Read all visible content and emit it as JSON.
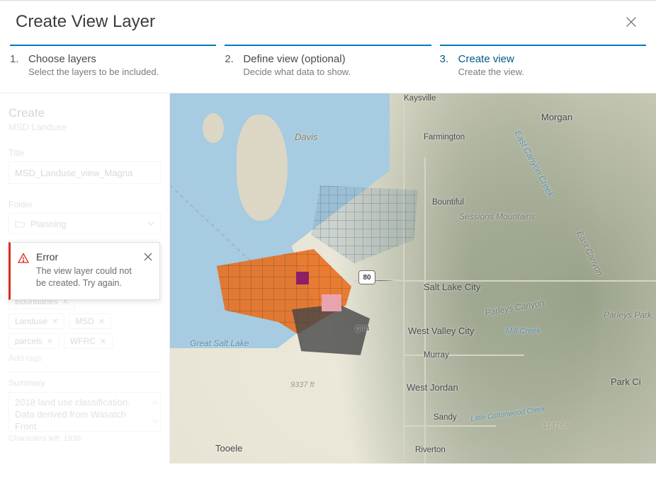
{
  "dialog": {
    "title": "Create View Layer"
  },
  "steps": [
    {
      "num": "1.",
      "title": "Choose layers",
      "sub": "Select the layers to be included."
    },
    {
      "num": "2.",
      "title": "Define view (optional)",
      "sub": "Decide what data to show."
    },
    {
      "num": "3.",
      "title": "Create view",
      "sub": "Create the view."
    }
  ],
  "side": {
    "create_heading": "Create",
    "source_name": "MSD Landuse",
    "title_label": "Title",
    "title_value": "MSD_Landuse_view_Magna",
    "folder_label": "Folder",
    "folder_value": "Planning",
    "tags_hidden_first": "Boundaries",
    "tags": [
      "Landuse",
      "MSD",
      "parcels",
      "WFRC"
    ],
    "add_tags": "Add tags",
    "summary_label": "Summary",
    "summary_value": "2018 land use classification. Data derived from Wasatch Front",
    "chars_left": "Characters left: 1938"
  },
  "toast": {
    "title": "Error",
    "message": "The view layer could not be created. Try again."
  },
  "map": {
    "labels": {
      "kaysville": "Kaysville",
      "morgan": "Morgan",
      "davis": "Davis",
      "farmington": "Farmington",
      "east_canyon_creek": "East Canyon Creek",
      "bountiful": "Bountiful",
      "sessions_mountains": "Sessions Mountains",
      "east_canyon": "East Canyon",
      "slc": "Salt Lake City",
      "parleys_canyon": "Parleys Canyon",
      "parleys_park": "Parleys Park",
      "wvc": "West Valley City",
      "mill_creek": "Mill Creek",
      "gna": "gna",
      "murray": "Murray",
      "great_salt_lake": "Great Salt Lake",
      "west_jordan": "West Jordan",
      "park_ci": "Park Ci",
      "sandy": "Sandy",
      "little_cottonwood": "Little Cottonwood Creek",
      "riverton": "Riverton",
      "tooele": "Tooele",
      "elev_9337": "9337 ft",
      "elev_11476": "11476 ft",
      "hwy80": "80"
    }
  }
}
